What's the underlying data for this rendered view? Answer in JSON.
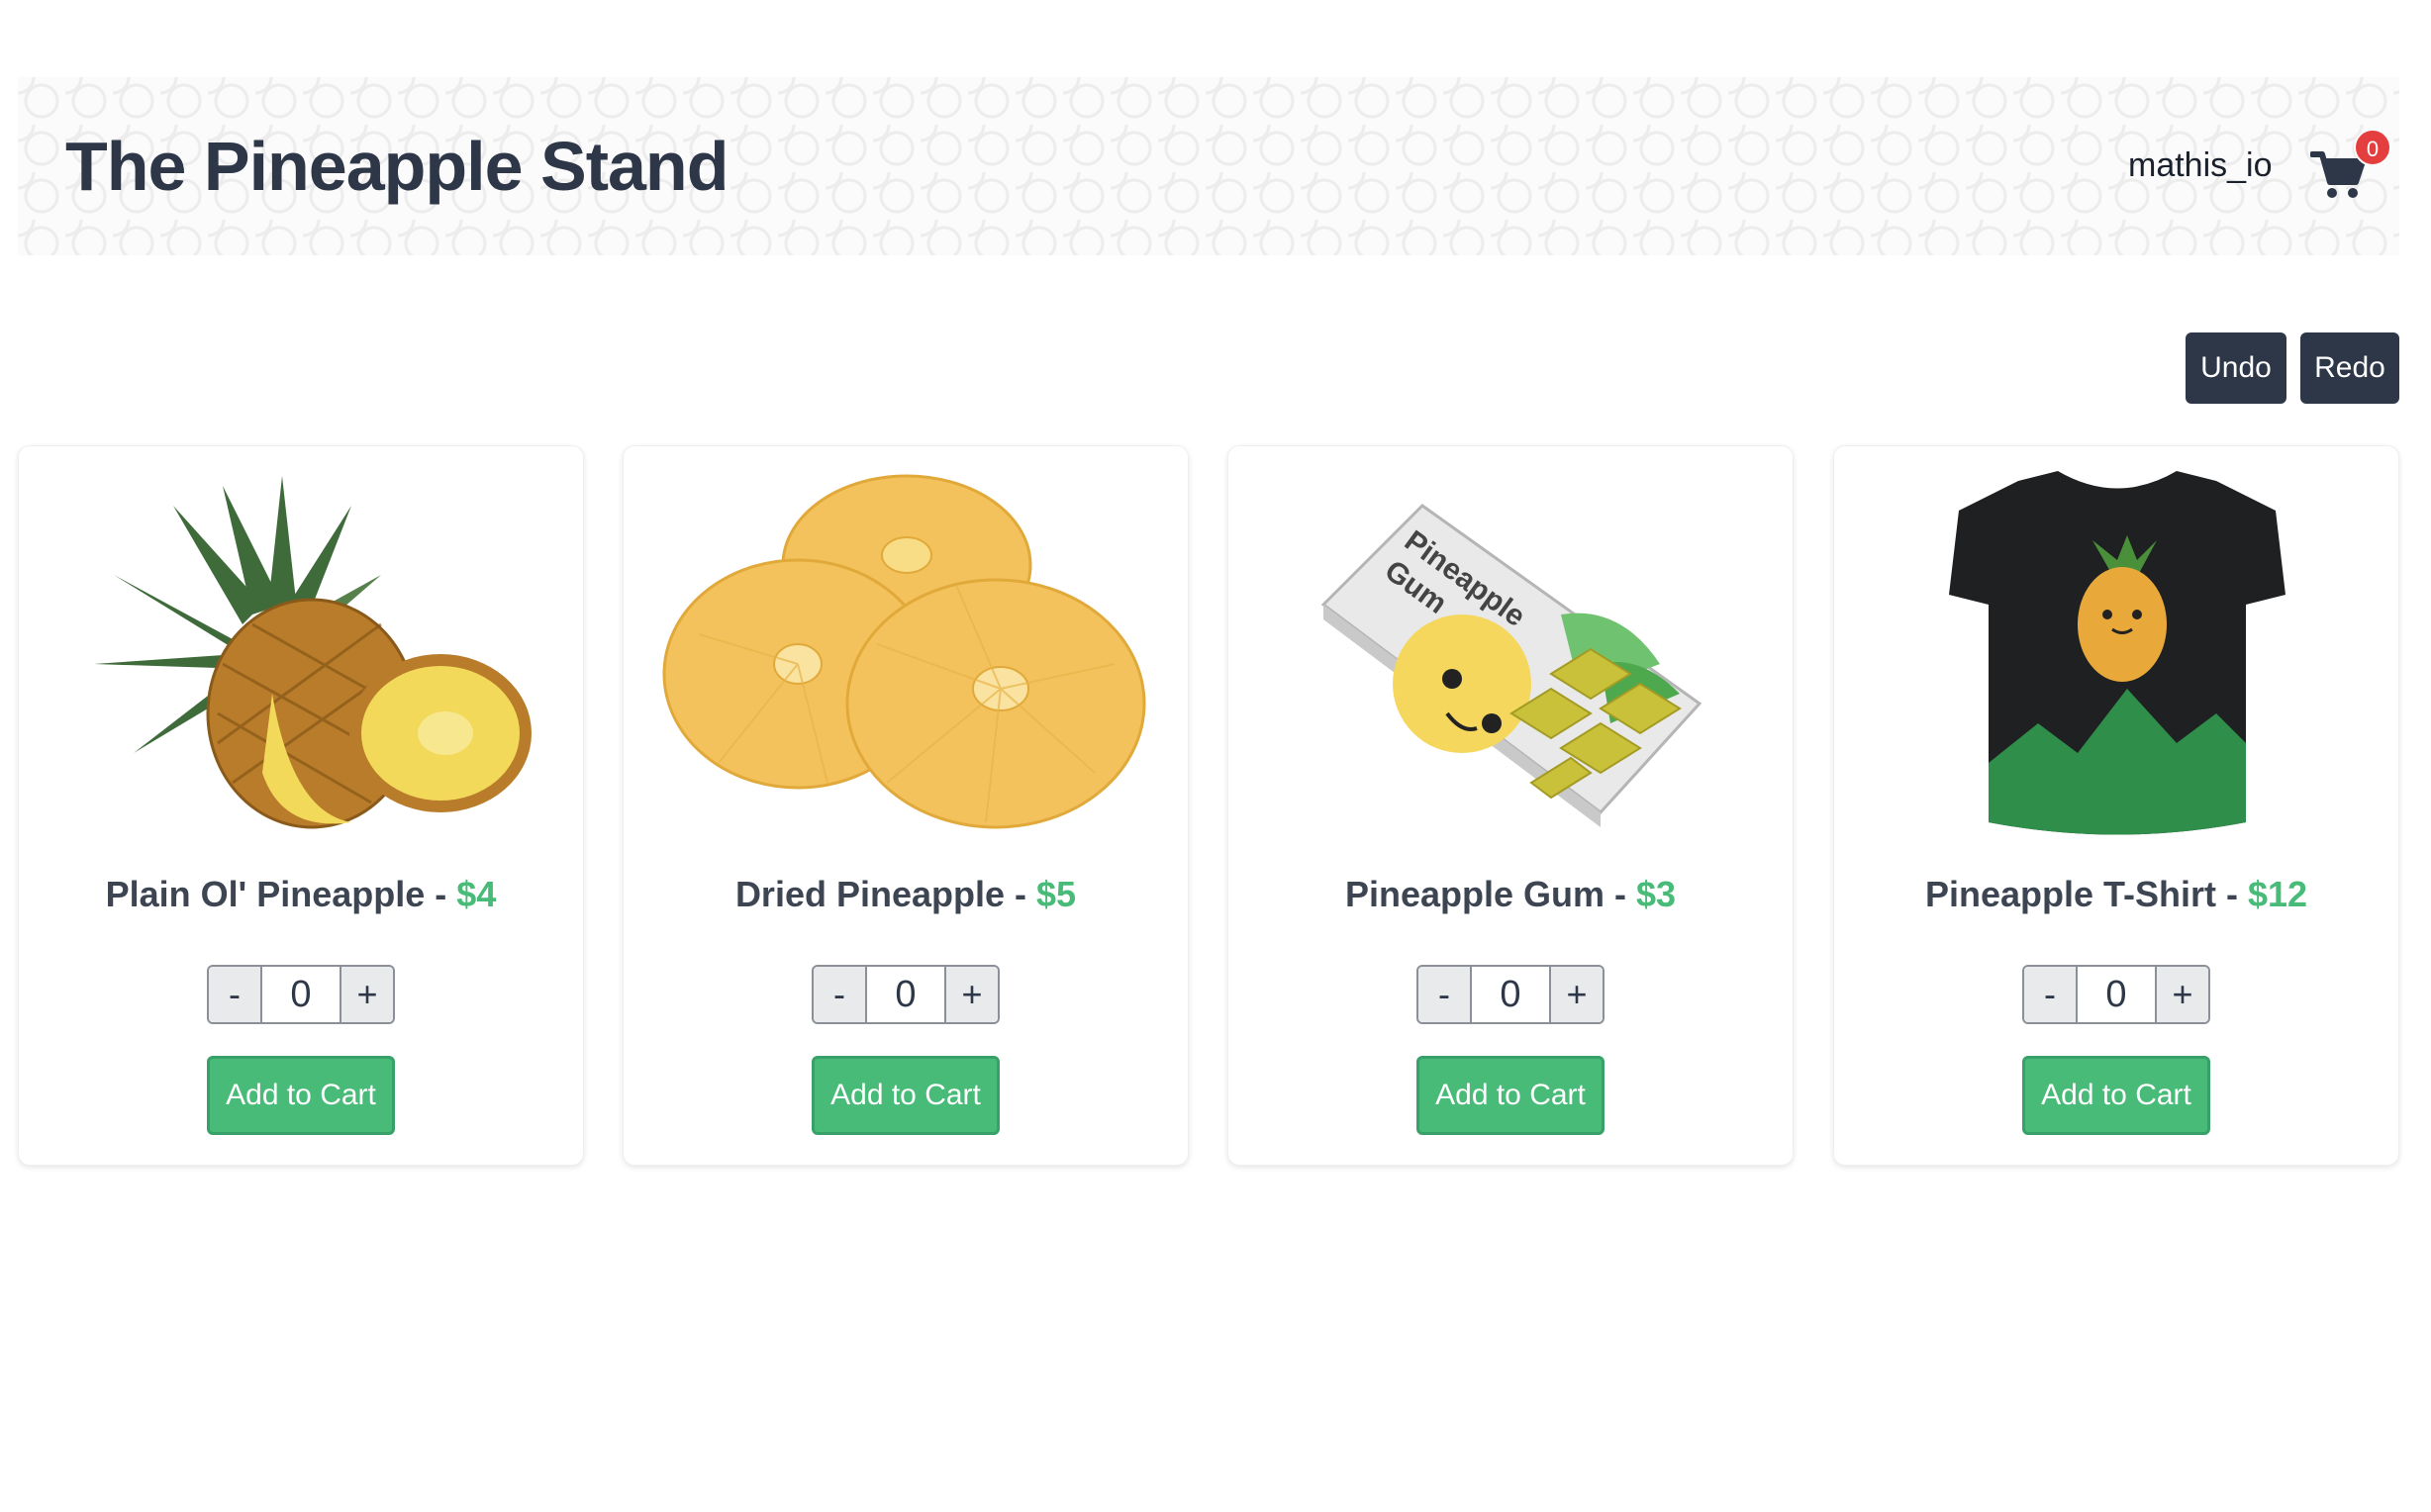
{
  "header": {
    "title": "The Pineapple Stand",
    "username": "mathis_io",
    "cart_count": "0",
    "cart_icon": "shopping-cart-icon",
    "badge_color": "#e53e3e"
  },
  "toolbar": {
    "undo_label": "Undo",
    "redo_label": "Redo"
  },
  "colors": {
    "accent": "#48bb78",
    "dark": "#2d3748"
  },
  "products": [
    {
      "name": "Plain Ol' Pineapple",
      "separator": " - ",
      "price": "$4",
      "quantity": "0",
      "decrement_label": "-",
      "increment_label": "+",
      "add_label": "Add to Cart",
      "image_icon": "pineapple-image"
    },
    {
      "name": "Dried Pineapple",
      "separator": " - ",
      "price": "$5",
      "quantity": "0",
      "decrement_label": "-",
      "increment_label": "+",
      "add_label": "Add to Cart",
      "image_icon": "dried-pineapple-image"
    },
    {
      "name": "Pineapple Gum",
      "separator": " - ",
      "price": "$3",
      "quantity": "0",
      "decrement_label": "-",
      "increment_label": "+",
      "add_label": "Add to Cart",
      "image_icon": "pineapple-gum-image",
      "package_text": [
        "Pineapple",
        "Gum"
      ]
    },
    {
      "name": "Pineapple T-Shirt",
      "separator": " - ",
      "price": "$12",
      "quantity": "0",
      "decrement_label": "-",
      "increment_label": "+",
      "add_label": "Add to Cart",
      "image_icon": "pineapple-tshirt-image"
    }
  ]
}
